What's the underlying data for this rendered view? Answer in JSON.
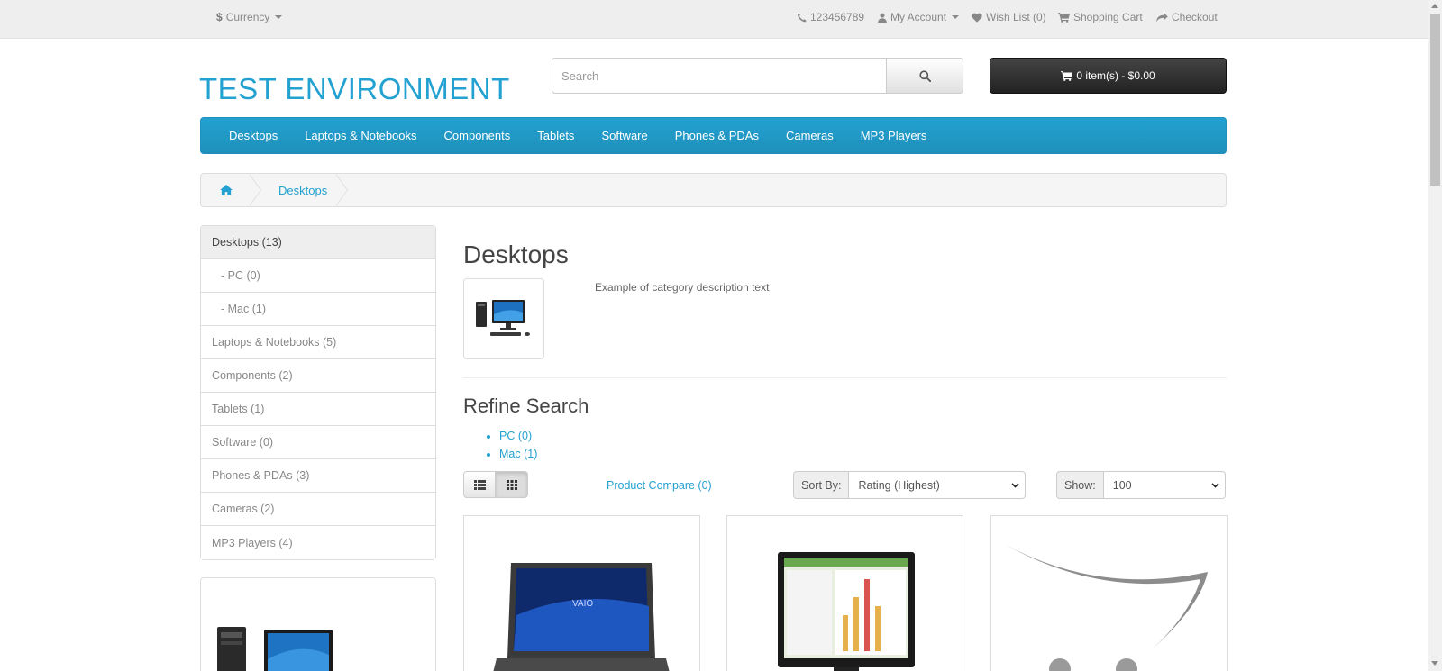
{
  "topbar": {
    "currency_symbol": "$",
    "currency_label": "Currency",
    "phone": "123456789",
    "my_account": "My Account",
    "wishlist": "Wish List (0)",
    "shopping_cart": "Shopping Cart",
    "checkout": "Checkout"
  },
  "header": {
    "logo": "TEST ENVIRONMENT",
    "search_placeholder": "Search",
    "cart_summary": "0 item(s) - $0.00"
  },
  "menu": [
    "Desktops",
    "Laptops & Notebooks",
    "Components",
    "Tablets",
    "Software",
    "Phones & PDAs",
    "Cameras",
    "MP3 Players"
  ],
  "breadcrumb": {
    "current": "Desktops"
  },
  "sidebar": [
    {
      "label": "Desktops (13)",
      "active": true
    },
    {
      "label": "- PC (0)",
      "sub": true
    },
    {
      "label": "- Mac (1)",
      "sub": true
    },
    {
      "label": "Laptops & Notebooks (5)"
    },
    {
      "label": "Components (2)"
    },
    {
      "label": "Tablets (1)"
    },
    {
      "label": "Software (0)"
    },
    {
      "label": "Phones & PDAs (3)"
    },
    {
      "label": "Cameras (2)"
    },
    {
      "label": "MP3 Players (4)"
    }
  ],
  "content": {
    "title": "Desktops",
    "description": "Example of category description text",
    "refine_title": "Refine Search",
    "refine_links": [
      "PC (0)",
      "Mac (1)"
    ],
    "compare_link": "Product Compare (0)",
    "sort_label": "Sort By:",
    "sort_value": "Rating (Highest)",
    "show_label": "Show:",
    "show_value": "100"
  },
  "colors": {
    "accent": "#23a1d1",
    "cart_button": "#222222",
    "topbar": "#eeeeee"
  }
}
